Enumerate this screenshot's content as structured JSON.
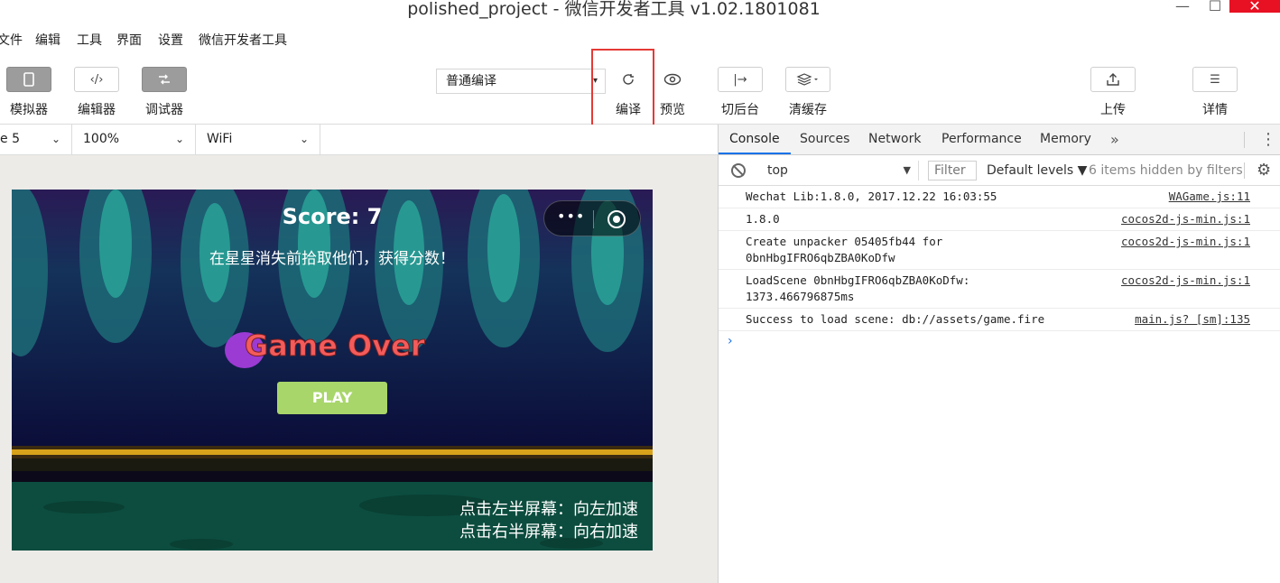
{
  "window": {
    "title": "polished_project - 微信开发者工具 v1.02.1801081",
    "min_glyph": "—",
    "max_glyph": "☐",
    "close_glyph": "✕"
  },
  "menu": {
    "items": [
      "文件",
      "编辑",
      "工具",
      "界面",
      "设置",
      "微信开发者工具"
    ]
  },
  "toolbar": {
    "simulator_label": "模拟器",
    "editor_label": "编辑器",
    "debugger_label": "调试器",
    "compile_mode": "普通编译",
    "compile_label": "编译",
    "preview_label": "预览",
    "background_label": "切后台",
    "clear_cache_label": "清缓存",
    "upload_label": "上传",
    "details_label": "详情",
    "editor_icon_glyph": "‹/›",
    "background_icon_glyph": "|→",
    "details_icon_glyph": "☰"
  },
  "simulator": {
    "device": "e 5",
    "zoom": "100%",
    "network": "WiFi"
  },
  "game": {
    "score_text": "Score: 7",
    "hint_top": "在星星消失前拾取他们，获得分数！",
    "game_over": "Game Over",
    "play_label": "PLAY",
    "hint_left": "点击左半屏幕：向左加速",
    "hint_right": "点击右半屏幕：向右加速"
  },
  "devtools": {
    "tabs": [
      "Console",
      "Sources",
      "Network",
      "Performance",
      "Memory"
    ],
    "active_tab": "Console",
    "more_glyph": "»",
    "context": "top",
    "filter_placeholder": "Filter",
    "levels": "Default levels ▼",
    "hidden_note": "6 items hidden by filters",
    "logs": [
      {
        "message": "Wechat Lib:1.8.0, 2017.12.22 16:03:55",
        "source": "WAGame.js:11"
      },
      {
        "message": "1.8.0",
        "source": "cocos2d-js-min.js:1"
      },
      {
        "message": "Create unpacker 05405fb44 for\n0bnHbgIFRO6qbZBA0KoDfw",
        "source": "cocos2d-js-min.js:1"
      },
      {
        "message": "LoadScene 0bnHbgIFRO6qbZBA0KoDfw:\n1373.466796875ms",
        "source": "cocos2d-js-min.js:1"
      },
      {
        "message": "Success to load scene: db://assets/game.fire",
        "source": "main.js? [sm]:135"
      }
    ],
    "prompt_glyph": "›"
  },
  "colors": {
    "highlight": "#e53935",
    "active_tab_underline": "#1a73e8",
    "game_bg": "#0c0b3a",
    "play_button": "#a8d66a"
  }
}
